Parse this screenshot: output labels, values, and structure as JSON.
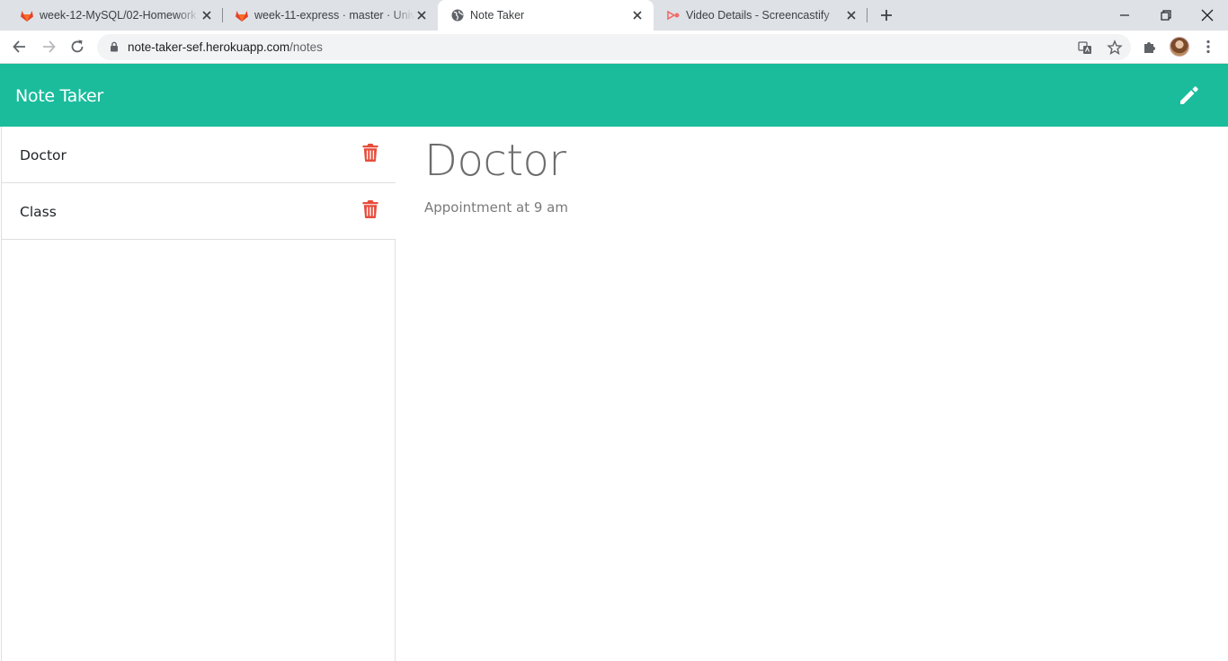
{
  "browser": {
    "tabs": [
      {
        "title": "week-12-MySQL/02-Homework ·",
        "icon": "gitlab-icon",
        "active": false
      },
      {
        "title": "week-11-express · master · Unive",
        "icon": "gitlab-icon",
        "active": false
      },
      {
        "title": "Note Taker",
        "icon": "globe-icon",
        "active": true
      },
      {
        "title": "Video Details - Screencastify",
        "icon": "screencastify-icon",
        "active": false
      }
    ],
    "url_host": "note-taker-sef.herokuapp.com",
    "url_path": "/notes"
  },
  "app": {
    "brand": "Note Taker",
    "accent": "#1abc9c",
    "trash_color": "#e74c3c"
  },
  "notes": [
    {
      "title": "Doctor"
    },
    {
      "title": "Class"
    }
  ],
  "active_note": {
    "title": "Doctor",
    "text": "Appointment at 9 am"
  }
}
